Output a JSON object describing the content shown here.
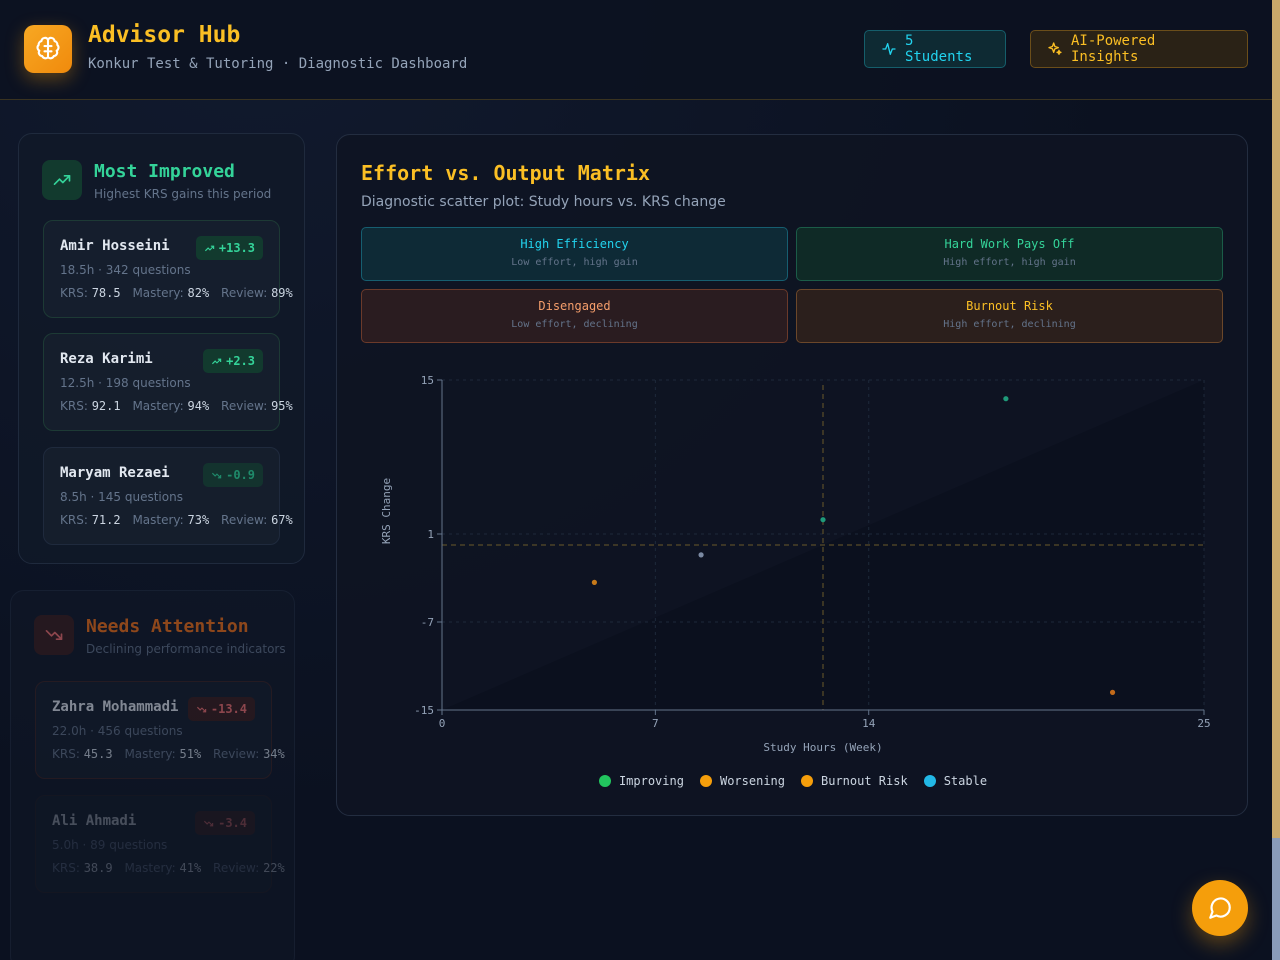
{
  "header": {
    "title": "Advisor Hub",
    "subtitle": "Konkur Test & Tutoring · Diagnostic Dashboard",
    "students_label": "5 Students",
    "ai_label": "AI-Powered Insights"
  },
  "improved": {
    "title": "Most Improved",
    "subtitle": "Highest KRS gains this period",
    "cards": [
      {
        "name": "Amir Hosseini",
        "meta": "18.5h · 342 questions",
        "badge": "+13.3",
        "krs": "78.5",
        "mastery": "82%",
        "review": "89%"
      },
      {
        "name": "Reza Karimi",
        "meta": "12.5h · 198 questions",
        "badge": "+2.3",
        "krs": "92.1",
        "mastery": "94%",
        "review": "95%"
      },
      {
        "name": "Maryam Rezaei",
        "meta": "8.5h · 145 questions",
        "badge": "-0.9",
        "krs": "71.2",
        "mastery": "73%",
        "review": "67%"
      }
    ]
  },
  "attention": {
    "title": "Needs Attention",
    "subtitle": "Declining performance indicators",
    "cards": [
      {
        "name": "Zahra Mohammadi",
        "meta": "22.0h · 456 questions",
        "badge": "-13.4",
        "krs": "45.3",
        "mastery": "51%",
        "review": "34%"
      },
      {
        "name": "Ali Ahmadi",
        "meta": "5.0h · 89 questions",
        "badge": "-3.4",
        "krs": "38.9",
        "mastery": "41%",
        "review": "22%"
      }
    ]
  },
  "labels": {
    "krs": "KRS:",
    "mastery": "Mastery:",
    "review": "Review:"
  },
  "main": {
    "title": "Effort vs. Output Matrix",
    "subtitle": "Diagnostic scatter plot: Study hours vs. KRS change",
    "quadrants": [
      {
        "title": "High Efficiency",
        "sub": "Low effort, high gain"
      },
      {
        "title": "Hard Work Pays Off",
        "sub": "High effort, high gain"
      },
      {
        "title": "Disengaged",
        "sub": "Low effort, declining"
      },
      {
        "title": "Burnout Risk",
        "sub": "High effort, declining"
      }
    ]
  },
  "chart_data": {
    "type": "scatter",
    "xlabel": "Study Hours (Week)",
    "ylabel": "KRS Change",
    "xlim": [
      0,
      25
    ],
    "ylim": [
      -15,
      15
    ],
    "x_ticks": [
      0,
      7,
      14,
      25
    ],
    "y_ticks": [
      15,
      1,
      -7,
      -15
    ],
    "x_threshold": 12.5,
    "y_threshold": 0,
    "points": [
      {
        "x": 18.5,
        "y": 13.3,
        "category": "Improving"
      },
      {
        "x": 12.5,
        "y": 2.3,
        "category": "Improving"
      },
      {
        "x": 8.5,
        "y": -0.9,
        "category": "Stable"
      },
      {
        "x": 5.0,
        "y": -3.4,
        "category": "Worsening"
      },
      {
        "x": 22.0,
        "y": -13.4,
        "category": "Burnout Risk"
      }
    ],
    "series": [
      {
        "name": "Improving",
        "color": "#22c55e"
      },
      {
        "name": "Worsening",
        "color": "#f59e0b"
      },
      {
        "name": "Burnout Risk",
        "color": "#f59e0b"
      },
      {
        "name": "Stable",
        "color": "#22b8e6"
      }
    ],
    "grid": true,
    "legend": "bottom-center"
  },
  "colors": {
    "accent": "#fbbf24",
    "improving": "#22c55e",
    "worsening": "#f59e0b",
    "stable": "#22b8e6"
  }
}
